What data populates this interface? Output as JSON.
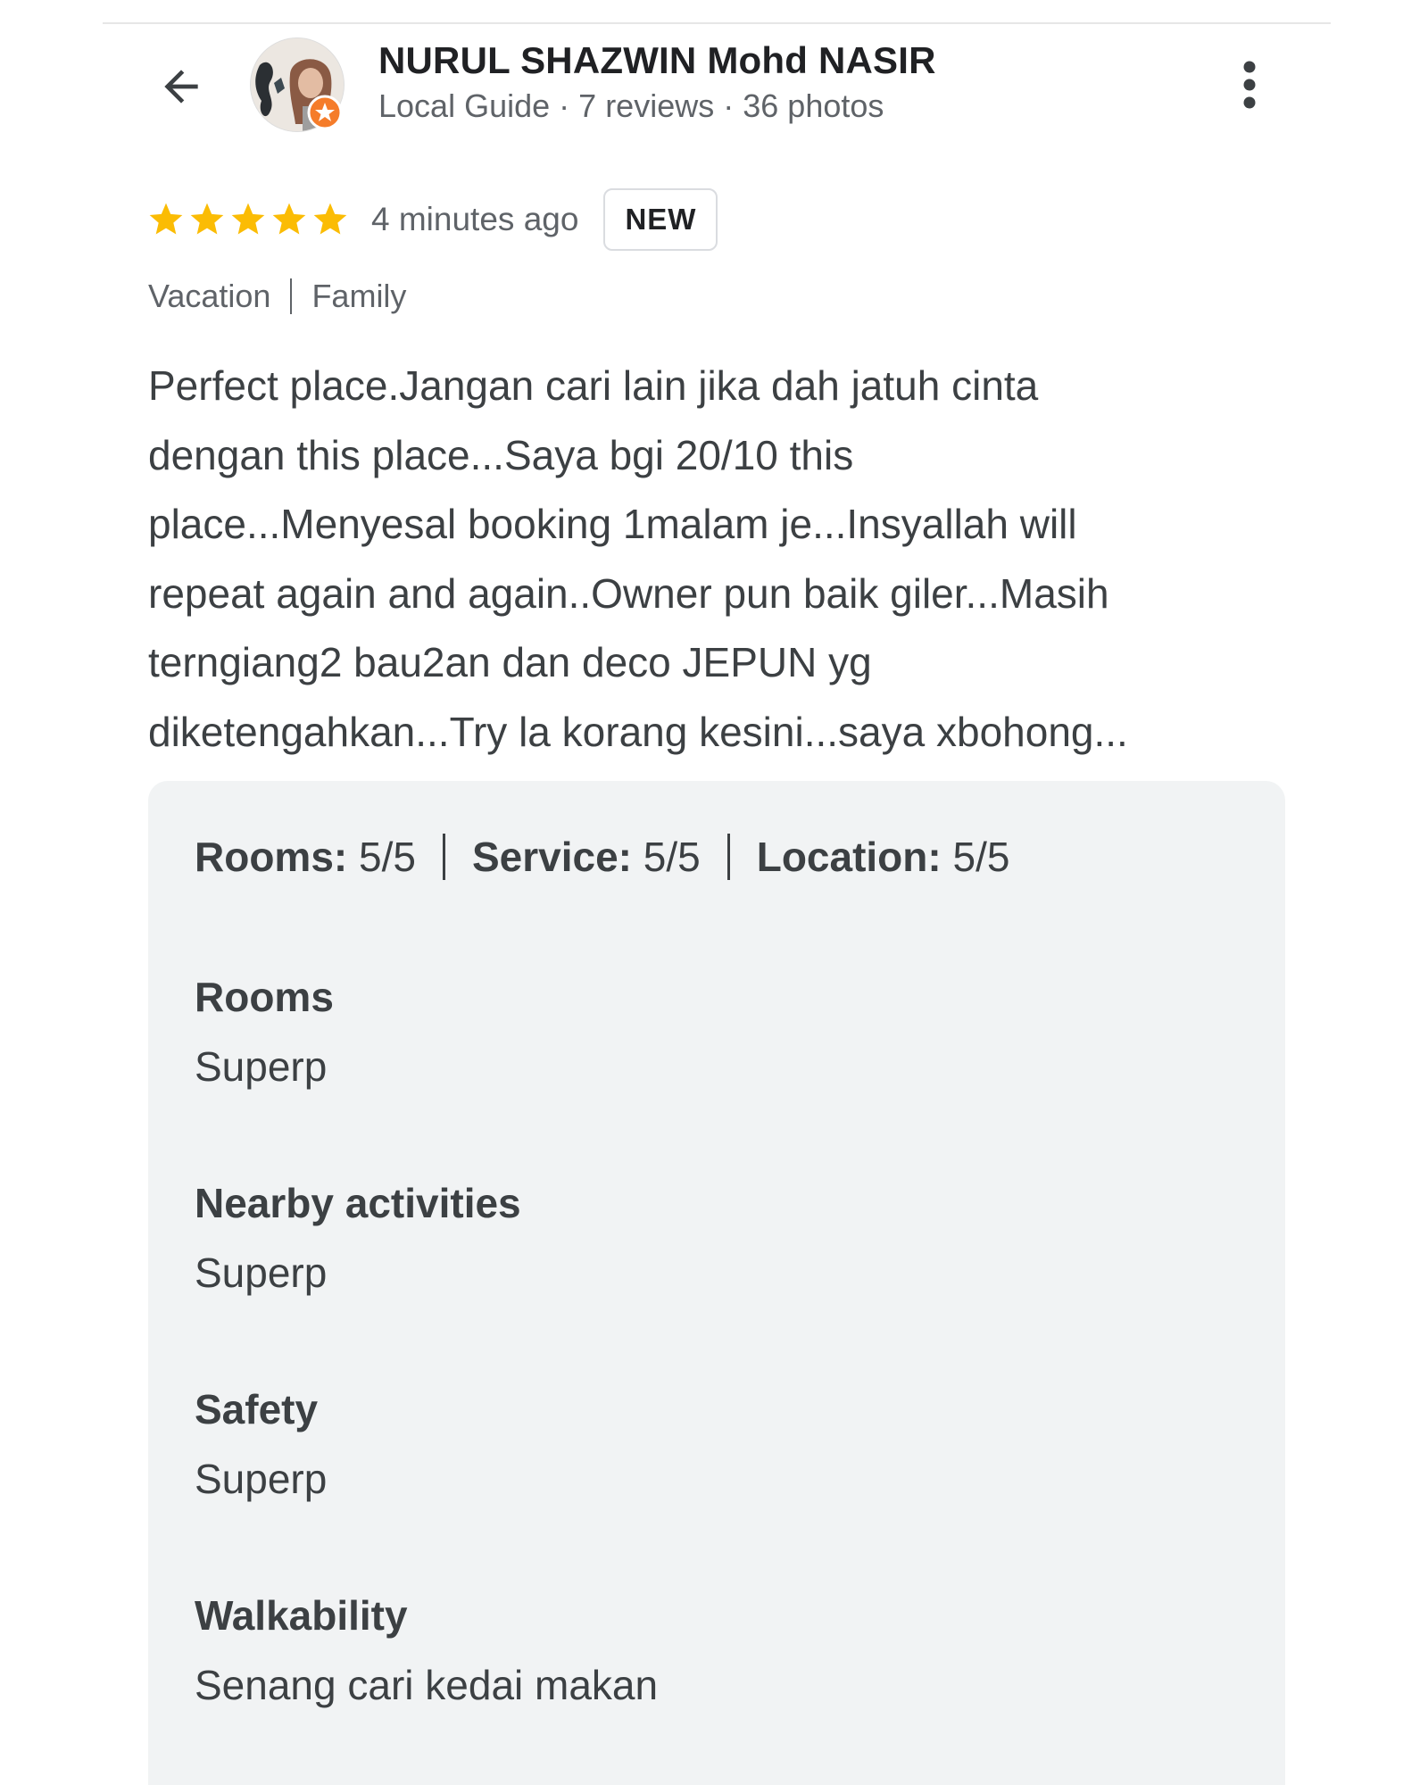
{
  "header": {
    "back_icon": "arrow-left-icon",
    "reviewer_name": "NURUL SHAZWIN Mohd NASIR",
    "guide_label": "Local Guide",
    "separator": "·",
    "reviews_count": "7 reviews",
    "photos_count": "36 photos",
    "badge_icon": "local-guide-star-icon",
    "more_icon": "more-vert-icon"
  },
  "review": {
    "rating": 5,
    "rating_max": 5,
    "star_color": "#fbbc04",
    "time_ago": "4 minutes ago",
    "new_badge": "NEW",
    "trip_type": "Vacation",
    "travel_group": "Family",
    "text_lines": [
      "Perfect place.Jangan cari lain jika dah jatuh cinta",
      "dengan this place...Saya bgi 20/10 this",
      "place...Menyesal booking 1malam je...Insyallah will",
      "repeat again and again..Owner pun baik giler...Masih",
      "terngiang2 bau2an dan deco JEPUN yg",
      "diketengahkan...Try la korang kesini...saya xbohong..."
    ]
  },
  "details": {
    "ratings": [
      {
        "label": "Rooms:",
        "value": "5/5"
      },
      {
        "label": "Service:",
        "value": "5/5"
      },
      {
        "label": "Location:",
        "value": "5/5"
      }
    ],
    "sections": [
      {
        "title": "Rooms",
        "value": "Superp"
      },
      {
        "title": "Nearby activities",
        "value": "Superp"
      },
      {
        "title": "Safety",
        "value": "Superp"
      },
      {
        "title": "Walkability",
        "value": "Senang cari kedai makan"
      }
    ]
  }
}
